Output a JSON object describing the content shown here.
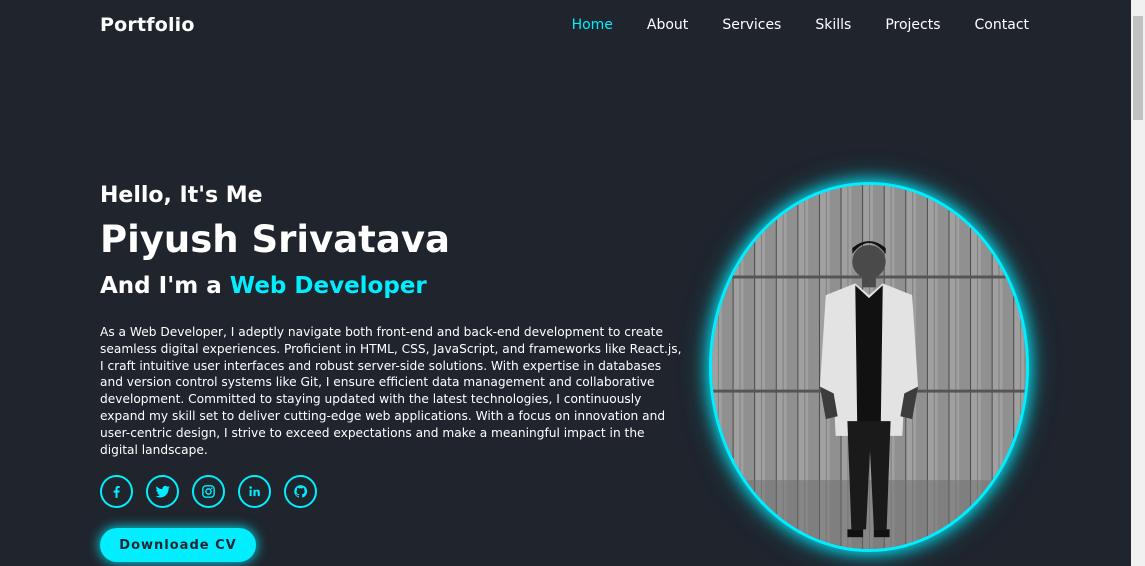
{
  "header": {
    "logo": "Portfolio",
    "nav": [
      {
        "label": "Home",
        "active": true
      },
      {
        "label": "About"
      },
      {
        "label": "Services"
      },
      {
        "label": "Skills"
      },
      {
        "label": "Projects"
      },
      {
        "label": "Contact"
      }
    ]
  },
  "home": {
    "greeting": "Hello, It's Me",
    "name": "Piyush Srivatava",
    "role_prefix": "And I'm a",
    "role_highlight": "Web Developer",
    "description": "As a Web Developer, I adeptly navigate both front-end and back-end development to create seamless digital experiences. Proficient in HTML, CSS, JavaScript, and frameworks like React.js, I craft intuitive user interfaces and robust server-side solutions. With expertise in databases and version control systems like Git, I ensure efficient data management and collaborative development. Committed to staying updated with the latest technologies, I continuously expand my skill set to deliver cutting-edge web applications. With a focus on innovation and user-centric design, I strive to exceed expectations and make a meaningful impact in the digital landscape.",
    "socials": [
      "facebook-icon",
      "twitter-icon",
      "instagram-icon",
      "linkedin-icon",
      "github-icon"
    ],
    "cv_button": "Downloade CV"
  },
  "colors": {
    "background": "#1f242d",
    "accent": "#00eeff",
    "text": "#ffffff"
  }
}
